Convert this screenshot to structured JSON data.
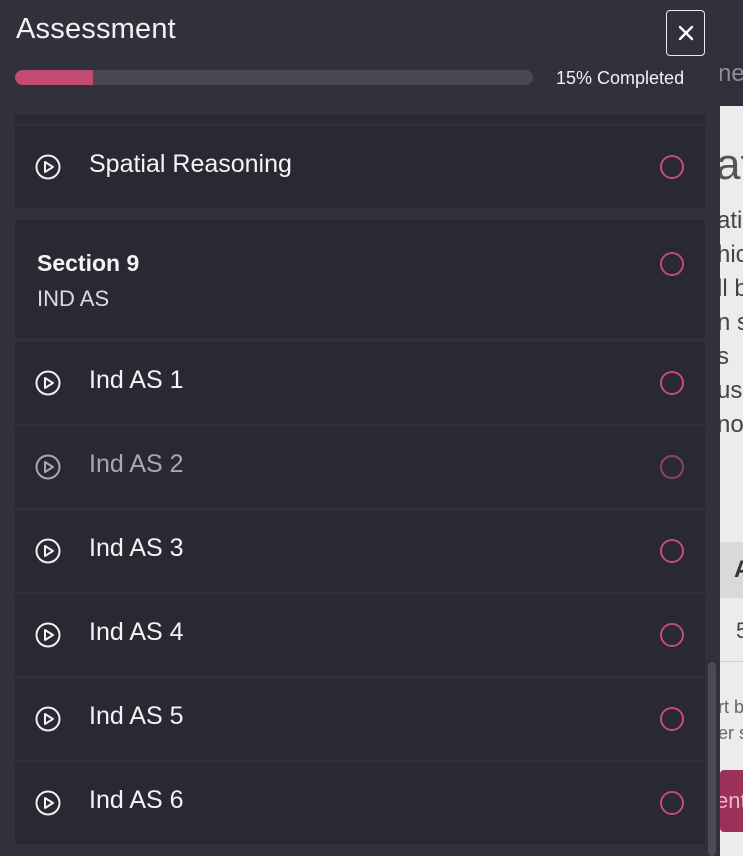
{
  "background_page": {
    "topbar_text": "ne",
    "heading_fragment": "at",
    "paragraph_lines": [
      "atio",
      "hic",
      "ll b",
      "n s",
      "s",
      "us",
      "nos"
    ],
    "table_header": "A",
    "table_cell": "5",
    "note_lines": [
      "rt b",
      "er s"
    ],
    "button_fragment": "ent"
  },
  "drawer": {
    "title": "Assessment",
    "close_icon": "close-icon",
    "progress": {
      "percent": 15,
      "label": "15% Completed"
    },
    "items": [
      {
        "type": "lesson",
        "label": "Spatial Reasoning",
        "dim": false
      },
      {
        "type": "section",
        "title": "Section 9",
        "subtitle": "IND AS"
      },
      {
        "type": "lesson",
        "label": "Ind AS 1",
        "dim": false
      },
      {
        "type": "lesson",
        "label": "Ind AS 2",
        "dim": true
      },
      {
        "type": "lesson",
        "label": "Ind AS 3",
        "dim": false
      },
      {
        "type": "lesson",
        "label": "Ind AS 4",
        "dim": false
      },
      {
        "type": "lesson",
        "label": "Ind AS 5",
        "dim": false
      },
      {
        "type": "lesson",
        "label": "Ind AS 6",
        "dim": false
      }
    ]
  },
  "colors": {
    "accent": "#c14b73",
    "drawer_bg": "#30313a",
    "card_bg": "#282932",
    "status_ring": "#c44a78"
  }
}
